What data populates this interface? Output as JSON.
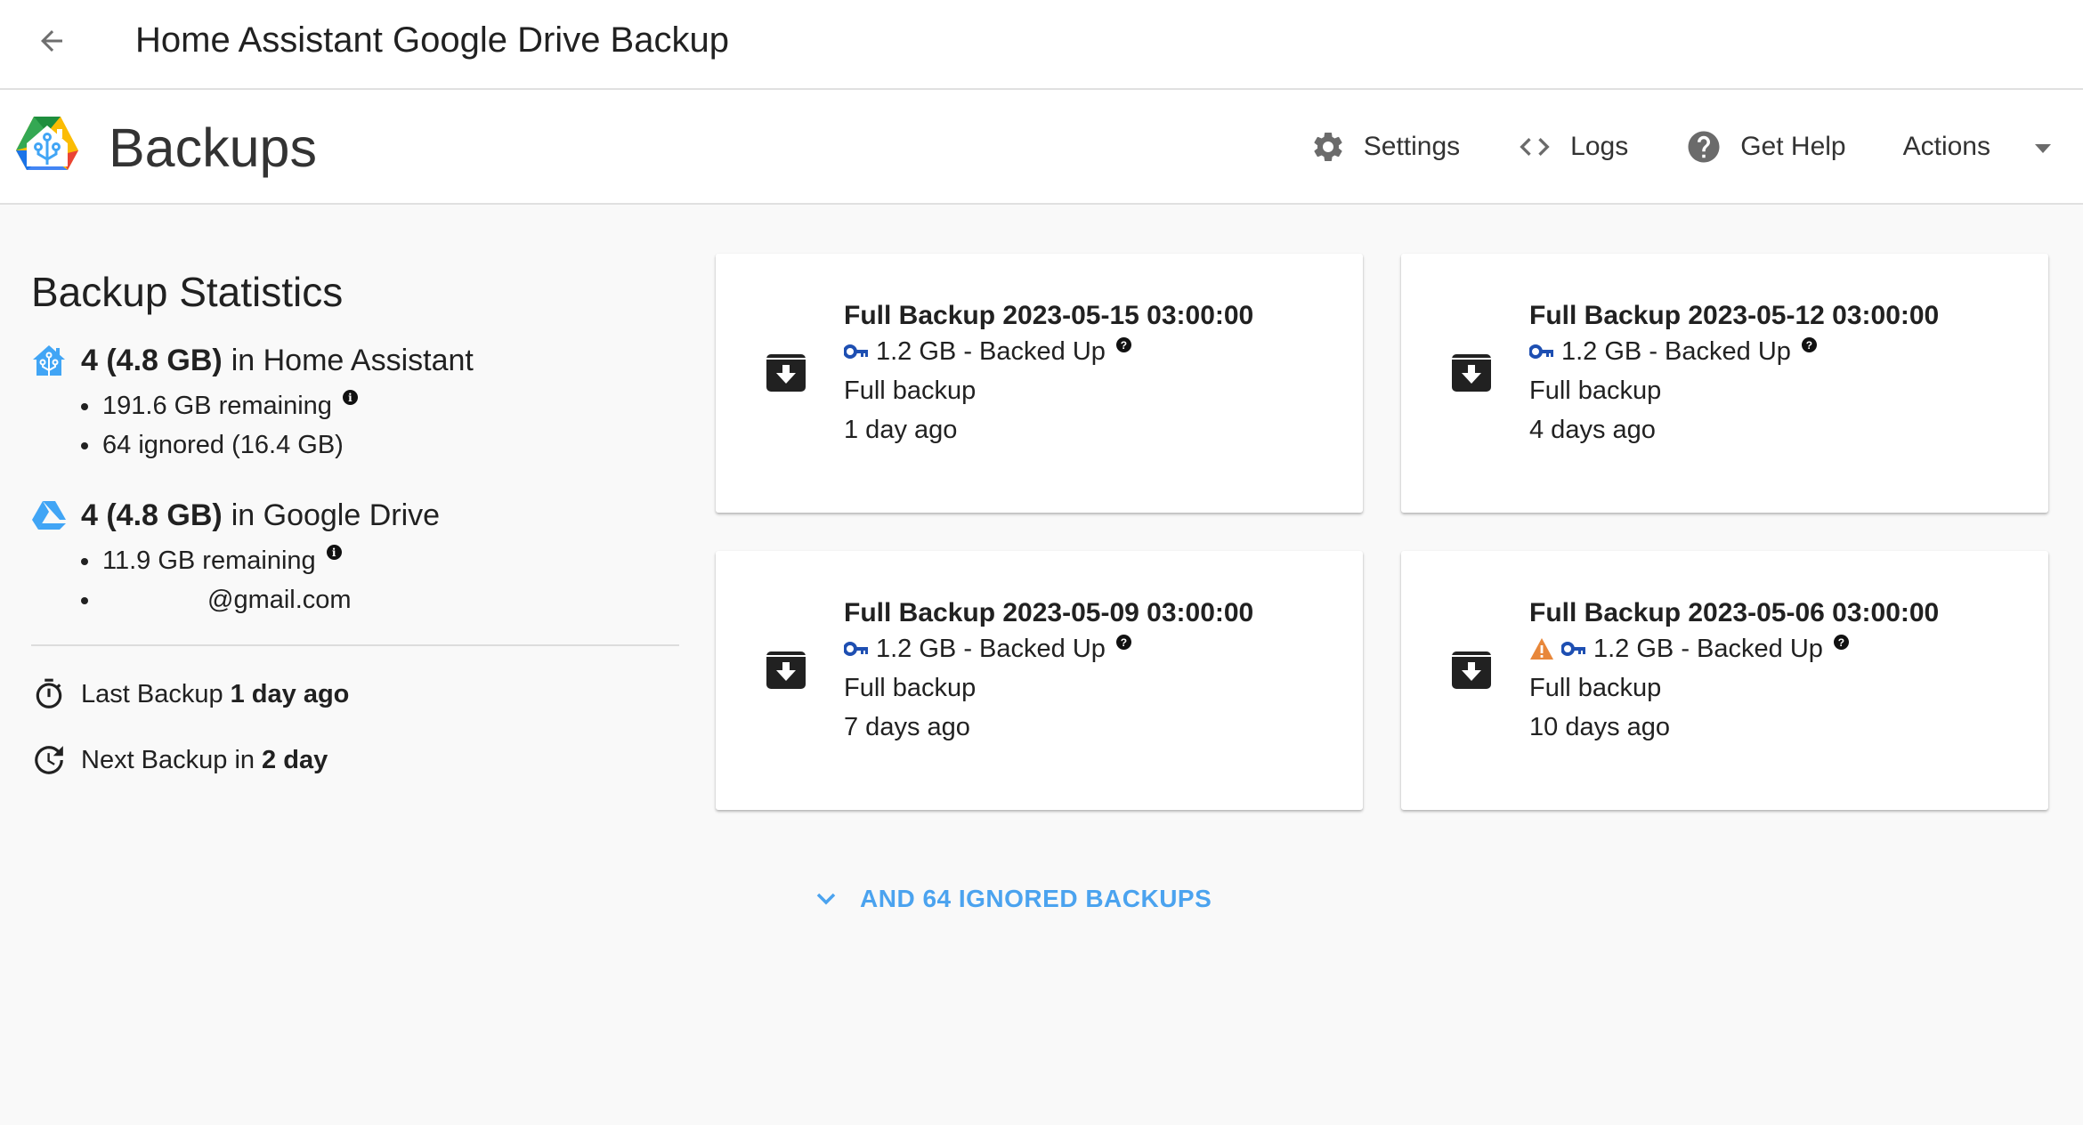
{
  "topbar": {
    "back_icon": "arrow-left-icon",
    "title": "Home Assistant Google Drive Backup"
  },
  "header": {
    "logo": "ha-google-drive-logo",
    "title": "Backups",
    "toolbar": {
      "settings": {
        "label": "Settings",
        "icon": "gear-icon"
      },
      "logs": {
        "label": "Logs",
        "icon": "code-icon"
      },
      "help": {
        "label": "Get Help",
        "icon": "help-circle-icon"
      },
      "actions": {
        "label": "Actions",
        "icon": "caret-down-icon"
      }
    }
  },
  "stats": {
    "title": "Backup Statistics",
    "home_assistant": {
      "icon": "home-assistant-icon",
      "count": "4 (4.8 GB)",
      "location": "in Home Assistant",
      "remaining": "191.6 GB remaining",
      "ignored": "64 ignored (16.4 GB)"
    },
    "google_drive": {
      "icon": "google-drive-icon",
      "count": "4 (4.8 GB)",
      "location": "in Google Drive",
      "remaining": "11.9 GB remaining",
      "account": "@gmail.com"
    },
    "last_backup": {
      "label": "Last Backup",
      "value": "1 day ago",
      "icon": "timer-icon"
    },
    "next_backup": {
      "label": "Next Backup in",
      "value": "2 day",
      "icon": "clock-refresh-icon"
    }
  },
  "backups": [
    {
      "name": "Full Backup 2023-05-15 03:00:00",
      "status": "1.2 GB - Backed Up",
      "type": "Full backup",
      "age": "1 day ago",
      "warning": false,
      "encrypted": true
    },
    {
      "name": "Full Backup 2023-05-12 03:00:00",
      "status": "1.2 GB - Backed Up",
      "type": "Full backup",
      "age": "4 days ago",
      "warning": false,
      "encrypted": true
    },
    {
      "name": "Full Backup 2023-05-09 03:00:00",
      "status": "1.2 GB - Backed Up",
      "type": "Full backup",
      "age": "7 days ago",
      "warning": false,
      "encrypted": true
    },
    {
      "name": "Full Backup 2023-05-06 03:00:00",
      "status": "1.2 GB - Backed Up",
      "type": "Full backup",
      "age": "10 days ago",
      "warning": true,
      "encrypted": true
    }
  ],
  "ignored_link": {
    "label": "AND 64 IGNORED BACKUPS",
    "icon": "chevron-down-icon"
  },
  "colors": {
    "accent": "#4ba3ef",
    "key_icon": "#1e4fb2",
    "warning": "#e8873a",
    "ha_blue": "#41a5f5"
  }
}
